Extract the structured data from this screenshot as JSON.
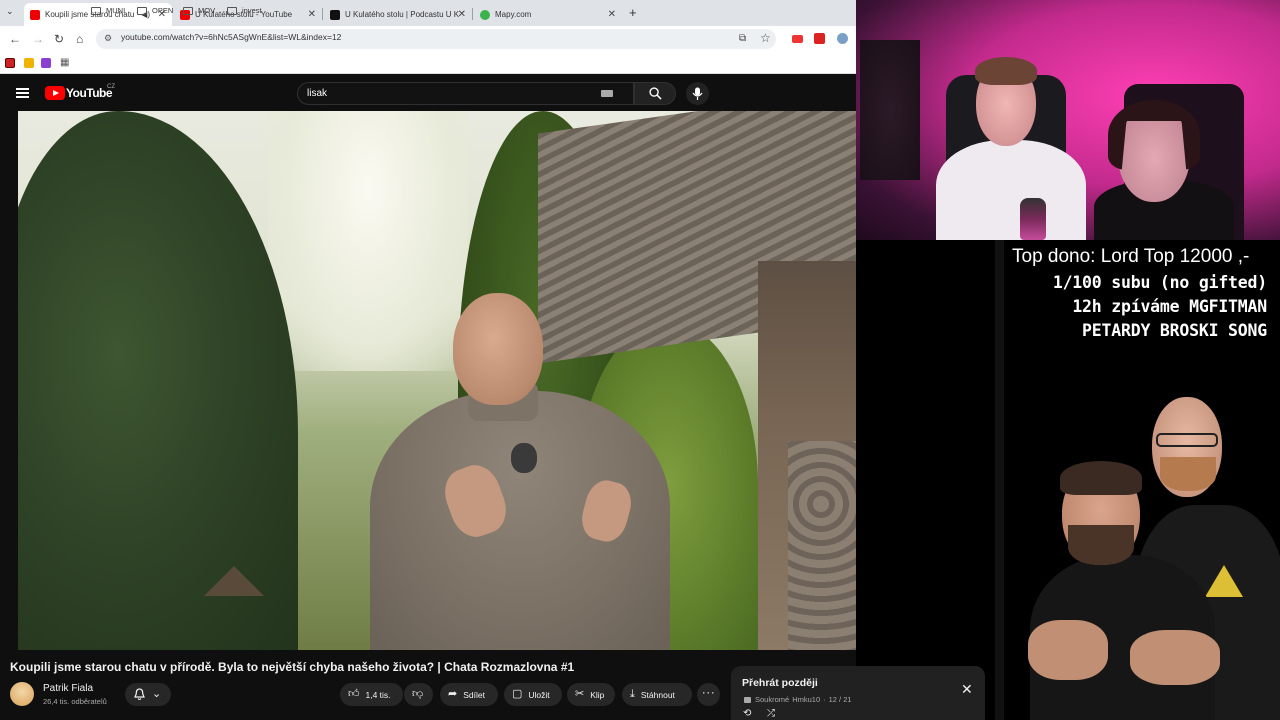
{
  "browser": {
    "tabs": [
      {
        "title": "Koupili jsme starou chatu v"
      },
      {
        "title": "U Kulatého stolu - YouTube"
      },
      {
        "title": "U Kulatého stolu | Podcastu U K"
      },
      {
        "title": "Mapy.com"
      }
    ],
    "url": "youtube.com/watch?v=6hNc5ASgWnE&list=WL&index=12",
    "bookmarks": [
      {
        "label": "MUNI"
      },
      {
        "label": "OPEN"
      },
      {
        "label": "MOV"
      },
      {
        "label": "invest"
      }
    ]
  },
  "youtube": {
    "logo_text": "YouTube",
    "country_code": "CZ",
    "search_value": "lisak"
  },
  "video": {
    "title": "Koupili jsme starou chatu v přírodě. Byla to největší chyba našeho života? | Chata Rozmazlovna #1",
    "channel": "Patrik Fiala",
    "subscribers": "26,4 tis. odběratelů",
    "likes": "1,4 tis.",
    "actions": {
      "share": "Sdílet",
      "save": "Uložit",
      "clip": "Klip",
      "download": "Stáhnout"
    }
  },
  "playlist": {
    "title": "Přehrát později",
    "privacy": "Soukromé",
    "owner": "Hmku10",
    "position": "12 / 21"
  },
  "overlay": {
    "top_donation": "Top dono: Lord Top 12000 ,-",
    "lines": [
      "1/100 subu (no gifted)",
      "12h zpíváme MGFITMAN",
      "PETARDY BROSKI SONG"
    ]
  },
  "colors": {
    "youtube_red": "#ff0000",
    "webcam_light": "#ff3fb4",
    "yt_background": "#0f0f0f"
  }
}
